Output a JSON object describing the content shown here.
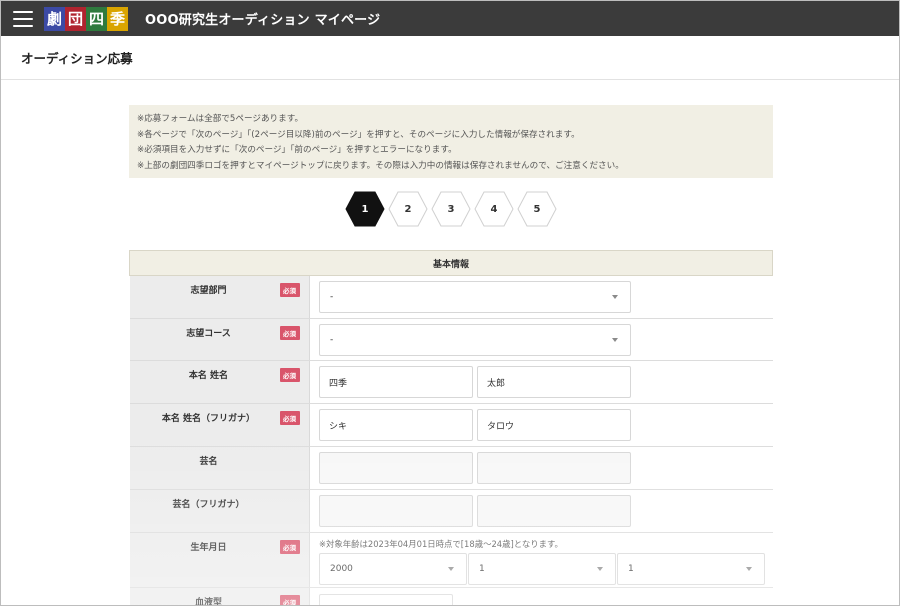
{
  "app": {
    "title": "OOO研究生オーディション マイページ",
    "logo_chars": [
      "劇",
      "団",
      "四",
      "季"
    ],
    "logo_colors": [
      "#3c4aa5",
      "#b0242f",
      "#2f7a3e",
      "#d9a400"
    ]
  },
  "page": {
    "title": "オーディション応募"
  },
  "notice": {
    "lines": [
      "※応募フォームは全部で5ページあります。",
      "※各ページで「次のページ」「(2ページ目以降)前のページ」を押すと、そのページに入力した情報が保存されます。",
      "※必須項目を入力せずに「次のページ」「前のページ」を押すとエラーになります。",
      "※上部の劇団四季ロゴを押すとマイページトップに戻ります。その際は入力中の情報は保存されませんので、ご注意ください。"
    ]
  },
  "steps": {
    "items": [
      "1",
      "2",
      "3",
      "4",
      "5"
    ],
    "active_index": 0,
    "active_color": "#111111",
    "inactive_stroke": "#d0d0d0"
  },
  "form": {
    "section_title": "基本情報",
    "required_label": "必須",
    "rows": [
      {
        "label": "志望部門",
        "required": true,
        "select_value": "-"
      },
      {
        "label": "志望コース",
        "required": true,
        "select_value": "-"
      },
      {
        "label": "本名 姓名",
        "required": true,
        "last": "四季",
        "first": "太郎"
      },
      {
        "label": "本名 姓名（フリガナ）",
        "required": true,
        "last": "シキ",
        "first": "タロウ"
      },
      {
        "label": "芸名",
        "required": false,
        "last": "",
        "first": ""
      },
      {
        "label": "芸名（フリガナ）",
        "required": false,
        "last": "",
        "first": ""
      },
      {
        "label": "生年月日",
        "required": true,
        "note": "※対象年齢は2023年04月01日時点で[18歳〜24歳]となります。",
        "year": "2000",
        "month": "1",
        "day": "1"
      },
      {
        "label": "血液型",
        "required": true
      }
    ]
  },
  "colors": {
    "topbar": "#3b3b3b",
    "required_badge": "#d9556b",
    "label_bg": "#ececec",
    "notice_bg": "#f1efe4"
  }
}
